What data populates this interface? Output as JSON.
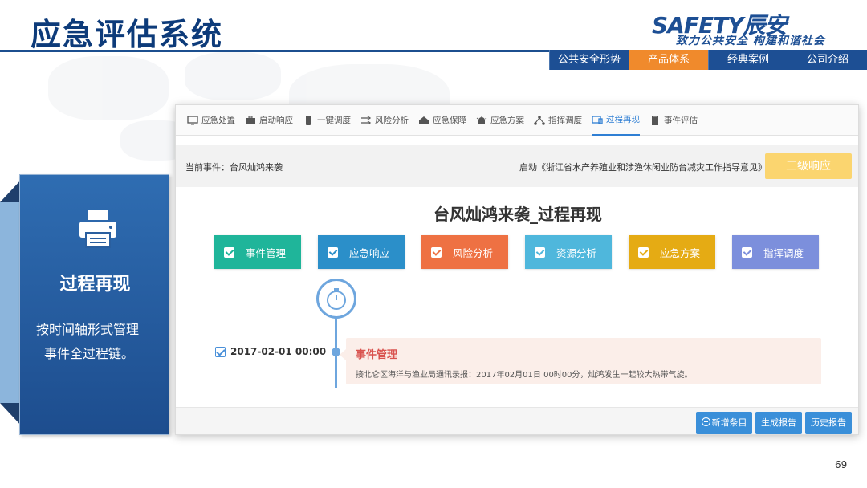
{
  "slide": {
    "title": "应急评估系统",
    "page_number": "69"
  },
  "logo": {
    "main": "SAFETY辰安",
    "tagline": "致力公共安全 构建和谐社会"
  },
  "top_nav": [
    {
      "label": "公共安全形势",
      "active": false
    },
    {
      "label": "产品体系",
      "active": true
    },
    {
      "label": "经典案例",
      "active": false
    },
    {
      "label": "公司介绍",
      "active": false
    }
  ],
  "side_panel": {
    "icon": "printer-icon",
    "title": "过程再现",
    "desc_line1": "按时间轴形式管理",
    "desc_line2": "事件全过程链。"
  },
  "app": {
    "toolbar": [
      {
        "label": "应急处置",
        "icon": "monitor-icon"
      },
      {
        "label": "启动响应",
        "icon": "briefcase-icon"
      },
      {
        "label": "一键调度",
        "icon": "phone-icon"
      },
      {
        "label": "风险分析",
        "icon": "shuffle-icon"
      },
      {
        "label": "应急保障",
        "icon": "home-icon"
      },
      {
        "label": "应急方案",
        "icon": "siren-icon"
      },
      {
        "label": "指挥调度",
        "icon": "sitemap-icon"
      },
      {
        "label": "过程再现",
        "icon": "screen-icon",
        "active": true
      },
      {
        "label": "事件评估",
        "icon": "clipboard-icon"
      }
    ],
    "current_event": "当前事件：台风灿鸿来袭",
    "launch_doc": "启动《浙江省水产养殖业和涉渔休闲业防台减灾工作指导意见》",
    "level_button": "三级响应",
    "replay_title": "台风灿鸿来袭_过程再现",
    "categories": [
      {
        "label": "事件管理",
        "color": "#1fb59a"
      },
      {
        "label": "应急响应",
        "color": "#2b8fc9"
      },
      {
        "label": "风险分析",
        "color": "#ee7143"
      },
      {
        "label": "资源分析",
        "color": "#4fb7dc"
      },
      {
        "label": "应急方案",
        "color": "#e5ab14"
      },
      {
        "label": "指挥调度",
        "color": "#7c8fdc"
      }
    ],
    "timeline": {
      "entry_time": "2017-02-01 00:00",
      "entry_heading": "事件管理",
      "entry_text": "接北仑区海洋与渔业局通讯录报：2017年02月01日 00时00分，灿鸿发生一起较大热带气旋。"
    },
    "buttons": {
      "add": "新增条目",
      "generate": "生成报告",
      "history": "历史报告"
    }
  }
}
